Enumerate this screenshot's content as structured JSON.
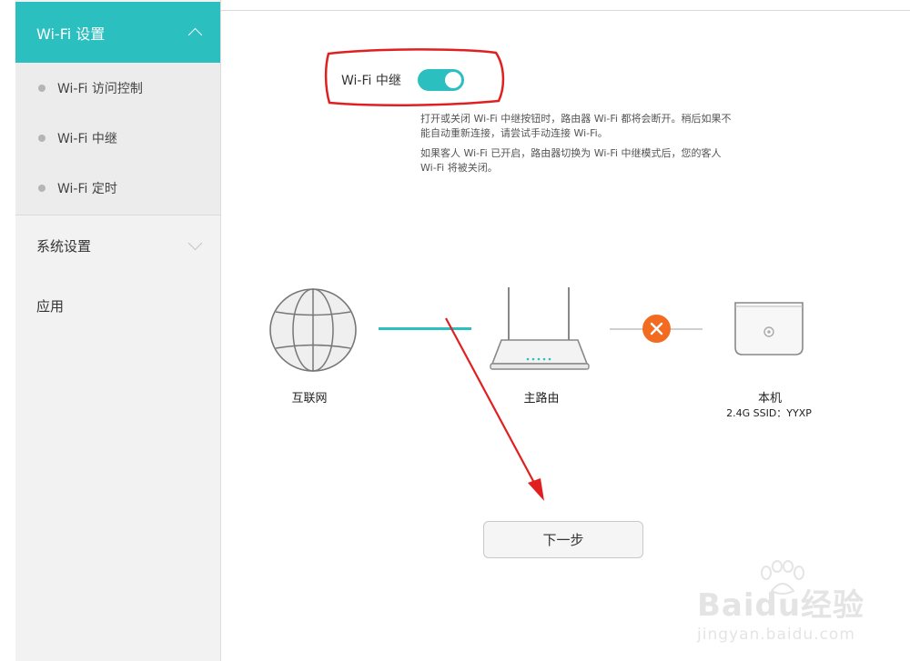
{
  "sidebar": {
    "header": {
      "title": "Wi-Fi 设置"
    },
    "sub_items": [
      {
        "label": "Wi-Fi 访问控制"
      },
      {
        "label": "Wi-Fi 中继"
      },
      {
        "label": "Wi-Fi 定时"
      }
    ],
    "menu": [
      {
        "label": "系统设置"
      },
      {
        "label": "应用"
      }
    ]
  },
  "repeater": {
    "label": "Wi-Fi 中继",
    "enabled": true,
    "desc1_line1": "打开或关闭 Wi-Fi 中继按钮时，路由器 Wi-Fi 都将会断开。稍后如果不",
    "desc1_line2": "能自动重新连接，请尝试手动连接 Wi-Fi。",
    "desc2_line1": "如果客人 Wi-Fi 已开启，路由器切换为 Wi-Fi 中继模式后，您的客人",
    "desc2_line2": "Wi-Fi 将被关闭。"
  },
  "diagram": {
    "internet_label": "互联网",
    "main_router_label": "主路由",
    "device_label": "本机",
    "ssid_text": "2.4G SSID：YYXP",
    "status": "disconnected"
  },
  "actions": {
    "next_label": "下一步"
  },
  "watermark": {
    "logo": "Baidu经验",
    "url": "jingyan.baidu.com"
  },
  "colors": {
    "accent": "#2bbfbf",
    "error": "#f26b20",
    "annotation": "#e02020"
  }
}
